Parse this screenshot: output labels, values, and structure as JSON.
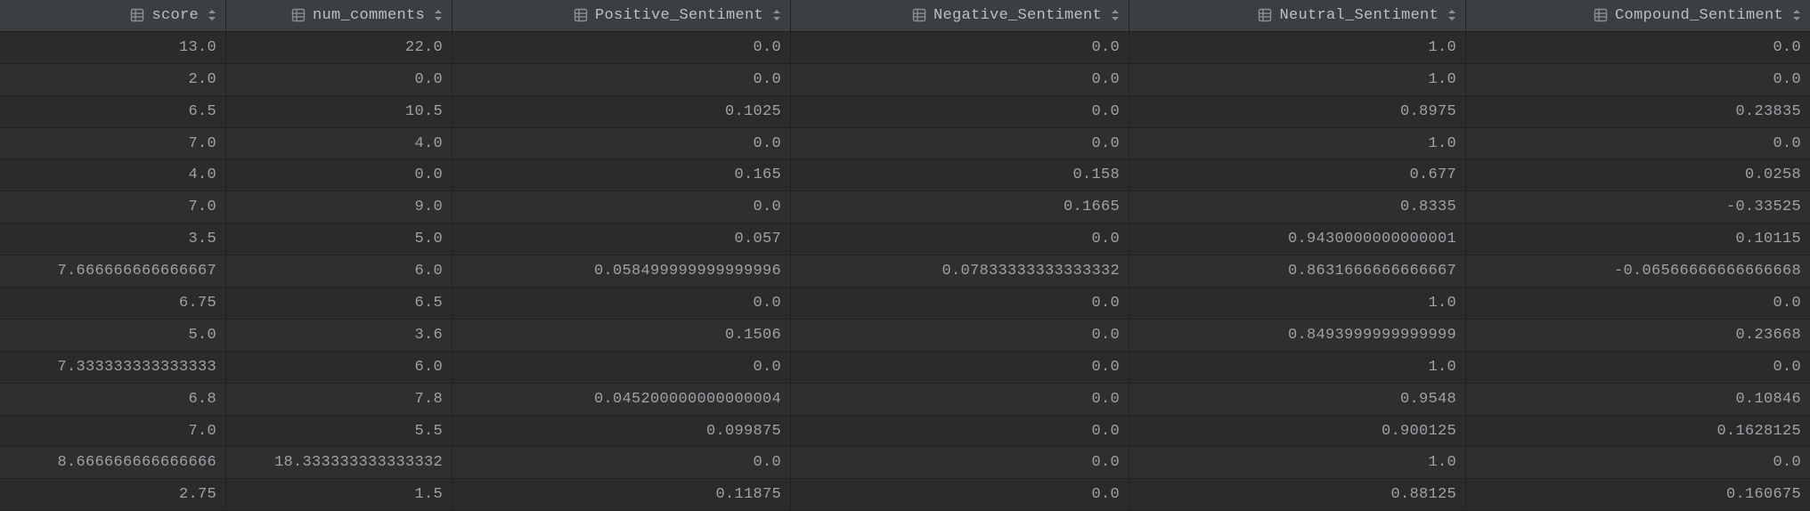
{
  "columns": [
    {
      "name": "score",
      "type": "numeric"
    },
    {
      "name": "num_comments",
      "type": "numeric"
    },
    {
      "name": "Positive_Sentiment",
      "type": "numeric"
    },
    {
      "name": "Negative_Sentiment",
      "type": "numeric"
    },
    {
      "name": "Neutral_Sentiment",
      "type": "numeric"
    },
    {
      "name": "Compound_Sentiment",
      "type": "numeric"
    }
  ],
  "rows": [
    {
      "score": "13.0",
      "num_comments": "22.0",
      "Positive_Sentiment": "0.0",
      "Negative_Sentiment": "0.0",
      "Neutral_Sentiment": "1.0",
      "Compound_Sentiment": "0.0"
    },
    {
      "score": "2.0",
      "num_comments": "0.0",
      "Positive_Sentiment": "0.0",
      "Negative_Sentiment": "0.0",
      "Neutral_Sentiment": "1.0",
      "Compound_Sentiment": "0.0"
    },
    {
      "score": "6.5",
      "num_comments": "10.5",
      "Positive_Sentiment": "0.1025",
      "Negative_Sentiment": "0.0",
      "Neutral_Sentiment": "0.8975",
      "Compound_Sentiment": "0.23835"
    },
    {
      "score": "7.0",
      "num_comments": "4.0",
      "Positive_Sentiment": "0.0",
      "Negative_Sentiment": "0.0",
      "Neutral_Sentiment": "1.0",
      "Compound_Sentiment": "0.0"
    },
    {
      "score": "4.0",
      "num_comments": "0.0",
      "Positive_Sentiment": "0.165",
      "Negative_Sentiment": "0.158",
      "Neutral_Sentiment": "0.677",
      "Compound_Sentiment": "0.0258"
    },
    {
      "score": "7.0",
      "num_comments": "9.0",
      "Positive_Sentiment": "0.0",
      "Negative_Sentiment": "0.1665",
      "Neutral_Sentiment": "0.8335",
      "Compound_Sentiment": "-0.33525"
    },
    {
      "score": "3.5",
      "num_comments": "5.0",
      "Positive_Sentiment": "0.057",
      "Negative_Sentiment": "0.0",
      "Neutral_Sentiment": "0.9430000000000001",
      "Compound_Sentiment": "0.10115"
    },
    {
      "score": "7.666666666666667",
      "num_comments": "6.0",
      "Positive_Sentiment": "0.058499999999999996",
      "Negative_Sentiment": "0.07833333333333332",
      "Neutral_Sentiment": "0.8631666666666667",
      "Compound_Sentiment": "-0.06566666666666668"
    },
    {
      "score": "6.75",
      "num_comments": "6.5",
      "Positive_Sentiment": "0.0",
      "Negative_Sentiment": "0.0",
      "Neutral_Sentiment": "1.0",
      "Compound_Sentiment": "0.0"
    },
    {
      "score": "5.0",
      "num_comments": "3.6",
      "Positive_Sentiment": "0.1506",
      "Negative_Sentiment": "0.0",
      "Neutral_Sentiment": "0.8493999999999999",
      "Compound_Sentiment": "0.23668"
    },
    {
      "score": "7.333333333333333",
      "num_comments": "6.0",
      "Positive_Sentiment": "0.0",
      "Negative_Sentiment": "0.0",
      "Neutral_Sentiment": "1.0",
      "Compound_Sentiment": "0.0"
    },
    {
      "score": "6.8",
      "num_comments": "7.8",
      "Positive_Sentiment": "0.045200000000000004",
      "Negative_Sentiment": "0.0",
      "Neutral_Sentiment": "0.9548",
      "Compound_Sentiment": "0.10846"
    },
    {
      "score": "7.0",
      "num_comments": "5.5",
      "Positive_Sentiment": "0.099875",
      "Negative_Sentiment": "0.0",
      "Neutral_Sentiment": "0.900125",
      "Compound_Sentiment": "0.1628125"
    },
    {
      "score": "8.666666666666666",
      "num_comments": "18.333333333333332",
      "Positive_Sentiment": "0.0",
      "Negative_Sentiment": "0.0",
      "Neutral_Sentiment": "1.0",
      "Compound_Sentiment": "0.0"
    },
    {
      "score": "2.75",
      "num_comments": "1.5",
      "Positive_Sentiment": "0.11875",
      "Negative_Sentiment": "0.0",
      "Neutral_Sentiment": "0.88125",
      "Compound_Sentiment": "0.160675"
    }
  ]
}
